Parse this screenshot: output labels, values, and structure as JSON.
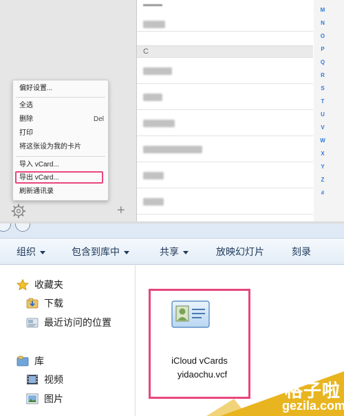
{
  "contacts": {
    "section_letter": "C",
    "alphabet": [
      "M",
      "N",
      "O",
      "P",
      "Q",
      "R",
      "S",
      "T",
      "U",
      "V",
      "W",
      "X",
      "Y",
      "Z",
      "#"
    ]
  },
  "context_menu": {
    "preferences": "偏好设置...",
    "select_all": "全选",
    "delete": "删除",
    "delete_shortcut": "Del",
    "print": "打印",
    "make_my_card": "将这张设为我的卡片",
    "import_vcard": "导入 vCard...",
    "export_vcard": "导出 vCard...",
    "refresh_contacts": "刷新通讯录"
  },
  "explorer": {
    "toolbar": {
      "organize": "组织",
      "include_in_library": "包含到库中",
      "share": "共享",
      "slideshow": "放映幻灯片",
      "burn": "刻录"
    },
    "sidebar": {
      "favorites": "收藏夹",
      "downloads": "下载",
      "recent_places": "最近访问的位置",
      "libraries": "库",
      "videos": "视频",
      "pictures": "图片"
    },
    "file": {
      "name_line1": "iCloud vCards",
      "name_line2": "yidaochu.vcf"
    }
  },
  "watermark": {
    "line1": "格子啦",
    "line2": "gezila.com"
  },
  "colors": {
    "highlight": "#e9457c",
    "alpha_index": "#2e7bd6",
    "watermark": "#e8b520"
  }
}
